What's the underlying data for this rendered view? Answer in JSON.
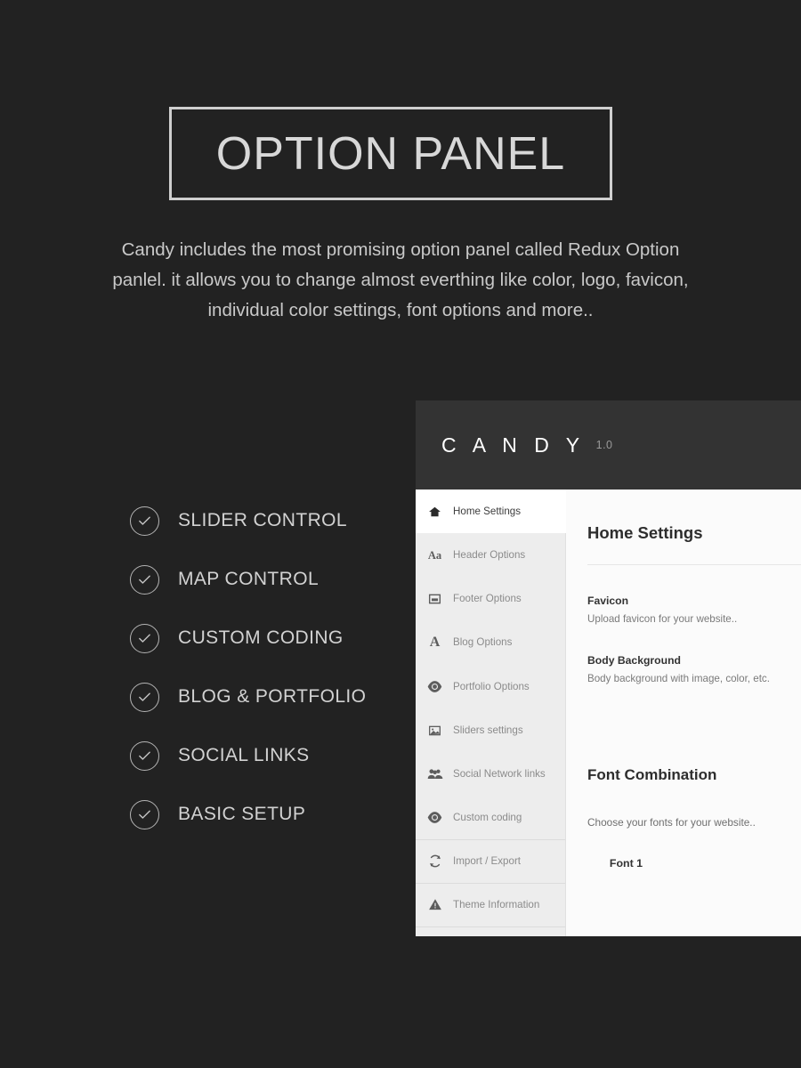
{
  "hero": {
    "title": "OPTION PANEL",
    "description": "Candy includes the most promising option panel called Redux Option panlel. it allows you to change almost everthing like color, logo, favicon, individual color settings, font options and more.."
  },
  "features": [
    {
      "label": "SLIDER CONTROL",
      "icon": "check-circle-icon"
    },
    {
      "label": "MAP CONTROL",
      "icon": "check-circle-icon"
    },
    {
      "label": "CUSTOM CODING",
      "icon": "check-circle-icon"
    },
    {
      "label": "BLOG & PORTFOLIO",
      "icon": "check-circle-icon"
    },
    {
      "label": "SOCIAL LINKS",
      "icon": "check-circle-icon"
    },
    {
      "label": "BASIC SETUP",
      "icon": "check-circle-icon"
    }
  ],
  "panel": {
    "brand": "C A N D Y",
    "version": "1.0",
    "sidebar": [
      {
        "label": "Home Settings",
        "icon": "home-icon",
        "active": true
      },
      {
        "label": "Header Options",
        "icon": "text-aa-icon",
        "active": false
      },
      {
        "label": "Footer Options",
        "icon": "footer-box-icon",
        "active": false
      },
      {
        "label": "Blog Options",
        "icon": "letter-a-icon",
        "active": false
      },
      {
        "label": "Portfolio Options",
        "icon": "eye-icon",
        "active": false
      },
      {
        "label": "Sliders settings",
        "icon": "image-icon",
        "active": false
      },
      {
        "label": "Social Network links",
        "icon": "users-icon",
        "active": false
      },
      {
        "label": "Custom coding",
        "icon": "eye-icon",
        "active": false
      },
      {
        "label": "Import / Export",
        "icon": "refresh-icon",
        "active": false
      },
      {
        "label": "Theme Information",
        "icon": "warning-icon",
        "active": false
      }
    ],
    "content": {
      "title": "Home Settings",
      "fields": [
        {
          "label": "Favicon",
          "desc": "Upload favicon for your website.."
        },
        {
          "label": "Body Background",
          "desc": "Body background with image, color, etc."
        }
      ],
      "section_heading": "Font Combination",
      "section_desc": "Choose your fonts for your website..",
      "font_row_label": "Font 1"
    }
  },
  "colors": {
    "page_background": "#222222",
    "panel_header": "#333333",
    "sidebar_background": "#ededed",
    "content_background": "#fbfbfb",
    "title_text": "#d8d8d8"
  }
}
